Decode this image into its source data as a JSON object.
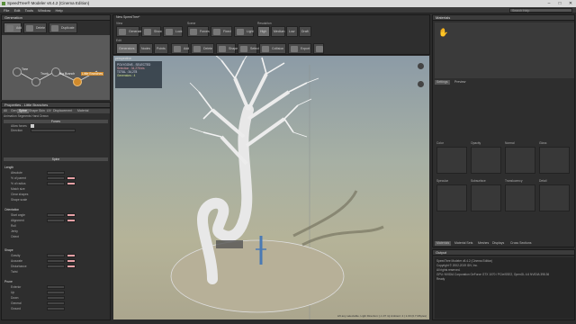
{
  "window": {
    "title": "SpeedTree® Modeler v8.4.2 (Cinema Edition)"
  },
  "menu": [
    "File",
    "Edit",
    "Tools",
    "Window",
    "Help"
  ],
  "search": {
    "placeholder": "Search Help"
  },
  "generation": {
    "title": "Generation",
    "buttons": [
      "Add",
      "Delete",
      "Duplicate"
    ],
    "nodes": [
      "Tree",
      "Trunk",
      "Big Branch",
      "Little Branches"
    ]
  },
  "properties": {
    "title": "Properties - Little Branches",
    "tabs": [
      "All",
      "Gen",
      "Spine",
      "Shape",
      "Skin",
      "UV",
      "Displacement",
      "Material"
    ],
    "subtabs": "Animation  Segments  Hand Drawn",
    "forces": {
      "header": "Forces",
      "allow": "Allow forces",
      "direction": "Direction"
    },
    "spine": "Spine",
    "length_header": "Length",
    "length_rows": [
      "Absolute",
      "% of parent",
      "% of radius",
      "Match size",
      "Clear shapes",
      "Shape scale"
    ],
    "orientation_header": "Orientation",
    "orientation_rows": [
      "Start angle",
      "Alignment",
      "Roll",
      "Jerky",
      "Orient"
    ],
    "shape_header": "Shape",
    "shape_rows": [
      "Gravity",
      "Accurate",
      "Disturbance",
      "Twist"
    ],
    "prune_header": "Prune",
    "prune_rows": [
      "Exterior",
      "Up",
      "Down",
      "General",
      "Ground"
    ]
  },
  "toolbar": {
    "tab": "New SpeedTree*",
    "view_label": "View",
    "view": [
      "Generate",
      "Show",
      "Lock"
    ],
    "scene_label": "Scene",
    "scene": [
      "Forces",
      "Fixed",
      "Light"
    ],
    "res_label": "Resolution",
    "res": [
      "High",
      "Medium",
      "Low",
      "Draft"
    ],
    "edit_label": "Edit",
    "edit": [
      "Generators",
      "Nodes",
      "Points",
      "Add",
      "Delete",
      "Shape",
      "Select",
      "Collision",
      "Export"
    ]
  },
  "viewport": {
    "label": "perspective",
    "stats": [
      "POLYGONS - SELECTED",
      "Selection : 34,278 tris",
      "TOTAL : 34,278",
      "Generators : 4"
    ],
    "status": "Lift any selectable. Light Direction: [-1.37 m] Ambient: 4 | 1.00 (0.7 Mbytes)"
  },
  "materials": {
    "title": "Materials",
    "settings_tabs": [
      "Settings",
      "Preview"
    ],
    "labels": [
      "Color",
      "Opacity",
      "Normal",
      "Gloss",
      "Specular",
      "Subsurface",
      "Translucency",
      "Detail"
    ],
    "bottom_tabs": [
      "Materials",
      "Material Sets",
      "Meshes",
      "Displays",
      "Cross Sections"
    ]
  },
  "output": {
    "title": "Output",
    "lines": [
      "SpeedTree Modeler v8.4.2 (Cinema Edition)",
      "Copyright © 2002-2019 IDV, Inc.",
      "All rights reserved.",
      "",
      "GPU: NVIDIA Corporation GeForce GTX 1070 / PCIe/SSE2, OpenGL 4.6 NVIDIA 398.36",
      "Ready"
    ]
  },
  "colors": {
    "accent": "#d08a2c",
    "viewport_bg": "#a7b0a4",
    "tree": "#e8e8e8"
  }
}
